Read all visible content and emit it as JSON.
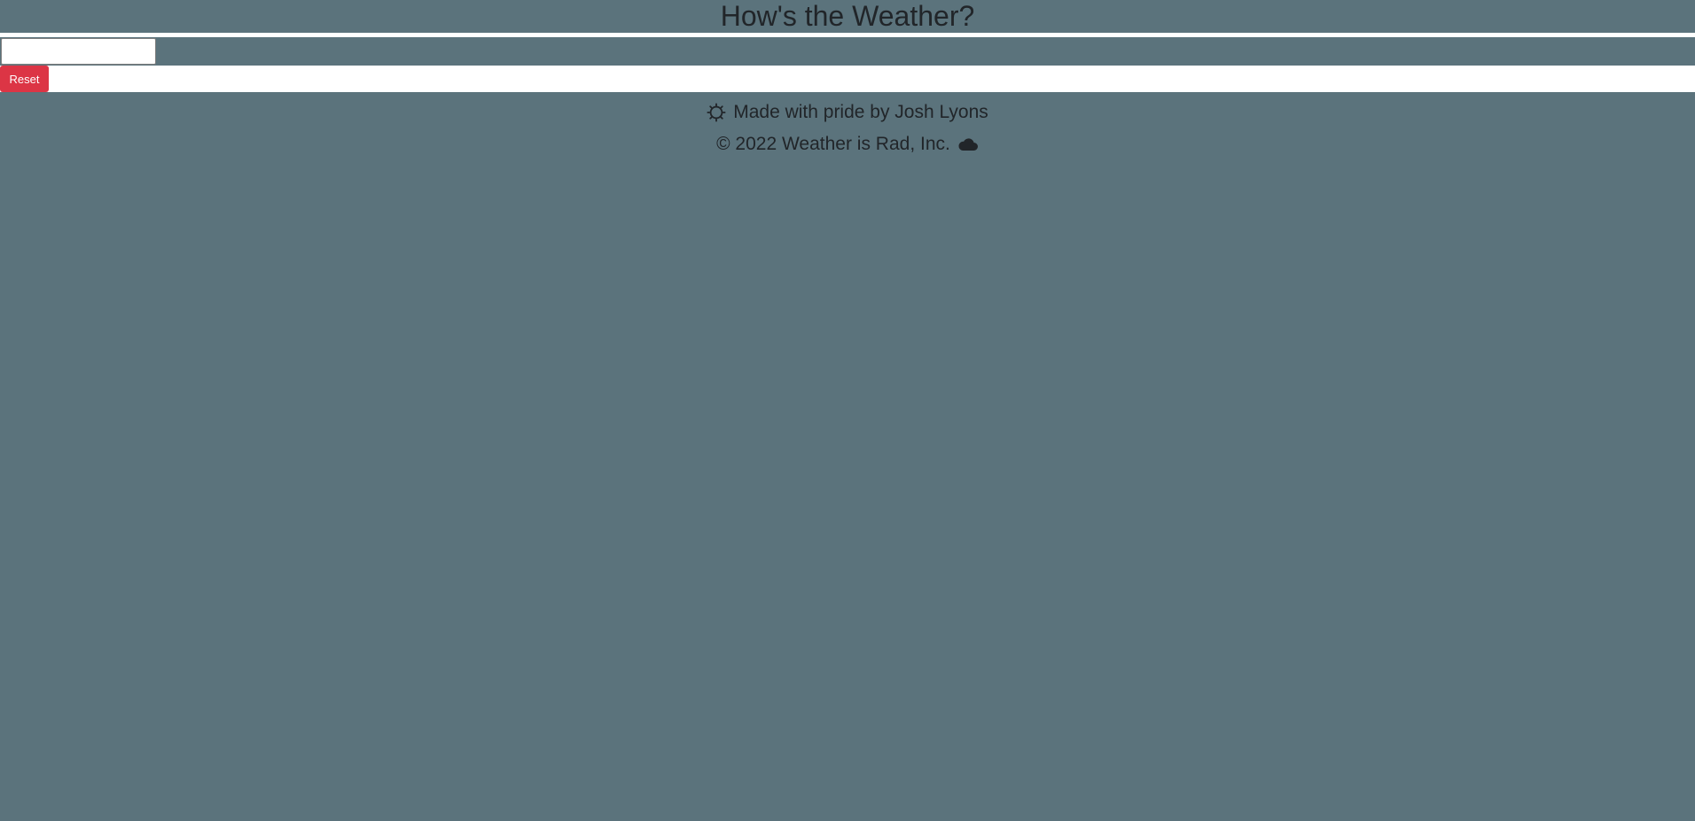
{
  "header": {
    "title": "How's the Weather?"
  },
  "search": {
    "value": "",
    "placeholder": "",
    "button_label": ""
  },
  "controls": {
    "reset_label": "Reset"
  },
  "footer": {
    "credit": "Made with pride by Josh Lyons",
    "credit_icon": "sun-icon",
    "copyright": "© 2022 Weather is Rad, Inc.",
    "copyright_icon": "cloud-icon"
  },
  "colors": {
    "background": "#5b737c",
    "reset_button": "#dc3545",
    "text": "#212529"
  }
}
